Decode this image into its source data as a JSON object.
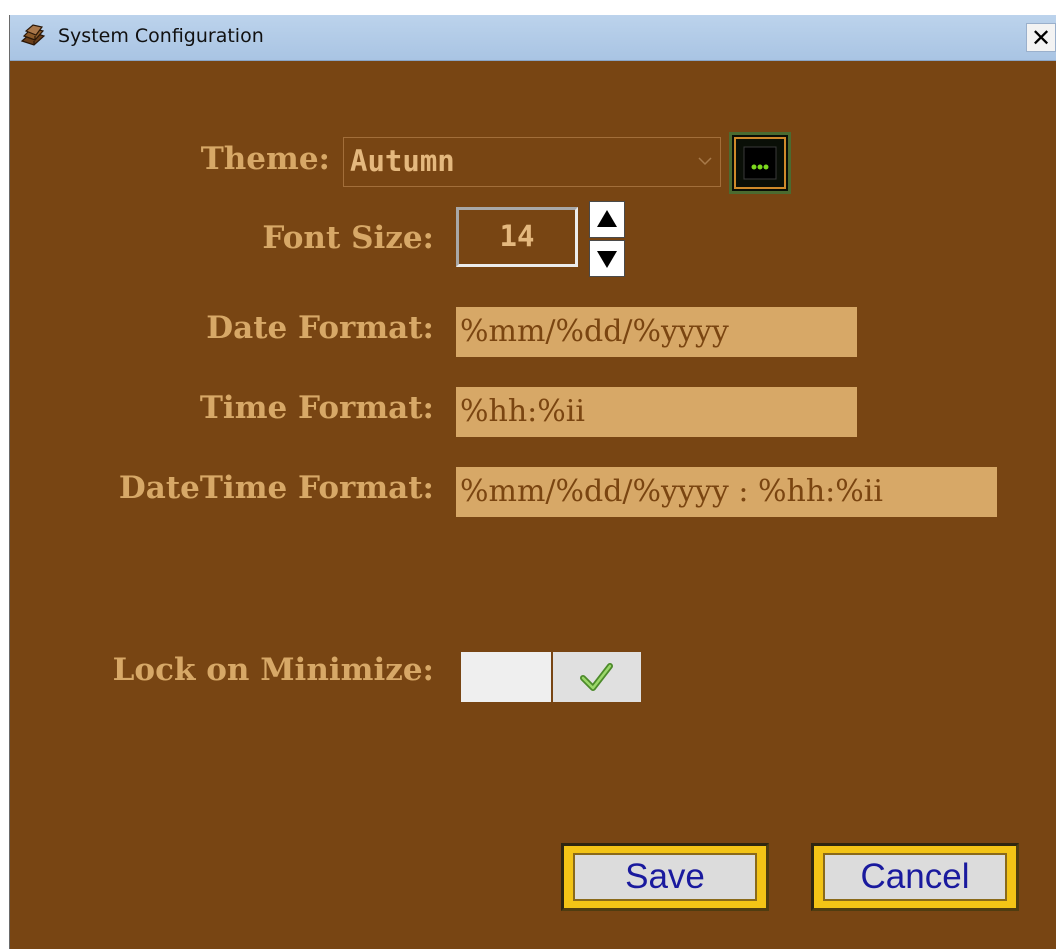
{
  "window": {
    "title": "System Configuration",
    "close_label": "✕",
    "app_icon": "books-icon"
  },
  "colors": {
    "window_bg": "#784513",
    "label_text": "#d7a867",
    "field_bg": "#d7a867",
    "field_text": "#7a4511",
    "button_border": "#f3c416",
    "button_text": "#1a1a9e",
    "titlebar": "#b3cce8"
  },
  "form": {
    "theme": {
      "label": "Theme:",
      "value": "Autumn",
      "picker_icon": "theme-preview-icon"
    },
    "font_size": {
      "label": "Font Size:",
      "value": "14",
      "up_icon": "arrow-up-icon",
      "down_icon": "arrow-down-icon"
    },
    "date_format": {
      "label": "Date Format:",
      "value": "%mm/%dd/%yyyy"
    },
    "time_format": {
      "label": "Time Format:",
      "value": "%hh:%ii"
    },
    "datetime_format": {
      "label": "DateTime Format:",
      "value": "%mm/%dd/%yyyy : %hh:%ii"
    },
    "lock_on_minimize": {
      "label": "Lock on Minimize:",
      "checked": true,
      "icon": "checkmark-icon"
    }
  },
  "buttons": {
    "save": "Save",
    "cancel": "Cancel"
  }
}
